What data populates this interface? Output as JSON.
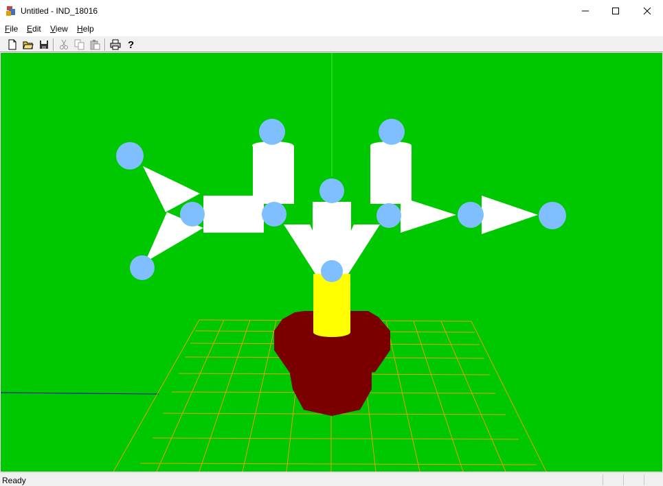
{
  "window": {
    "title": "Untitled - IND_18016"
  },
  "menu": [
    "File",
    "Edit",
    "View",
    "Help"
  ],
  "status": {
    "text": "Ready"
  }
}
